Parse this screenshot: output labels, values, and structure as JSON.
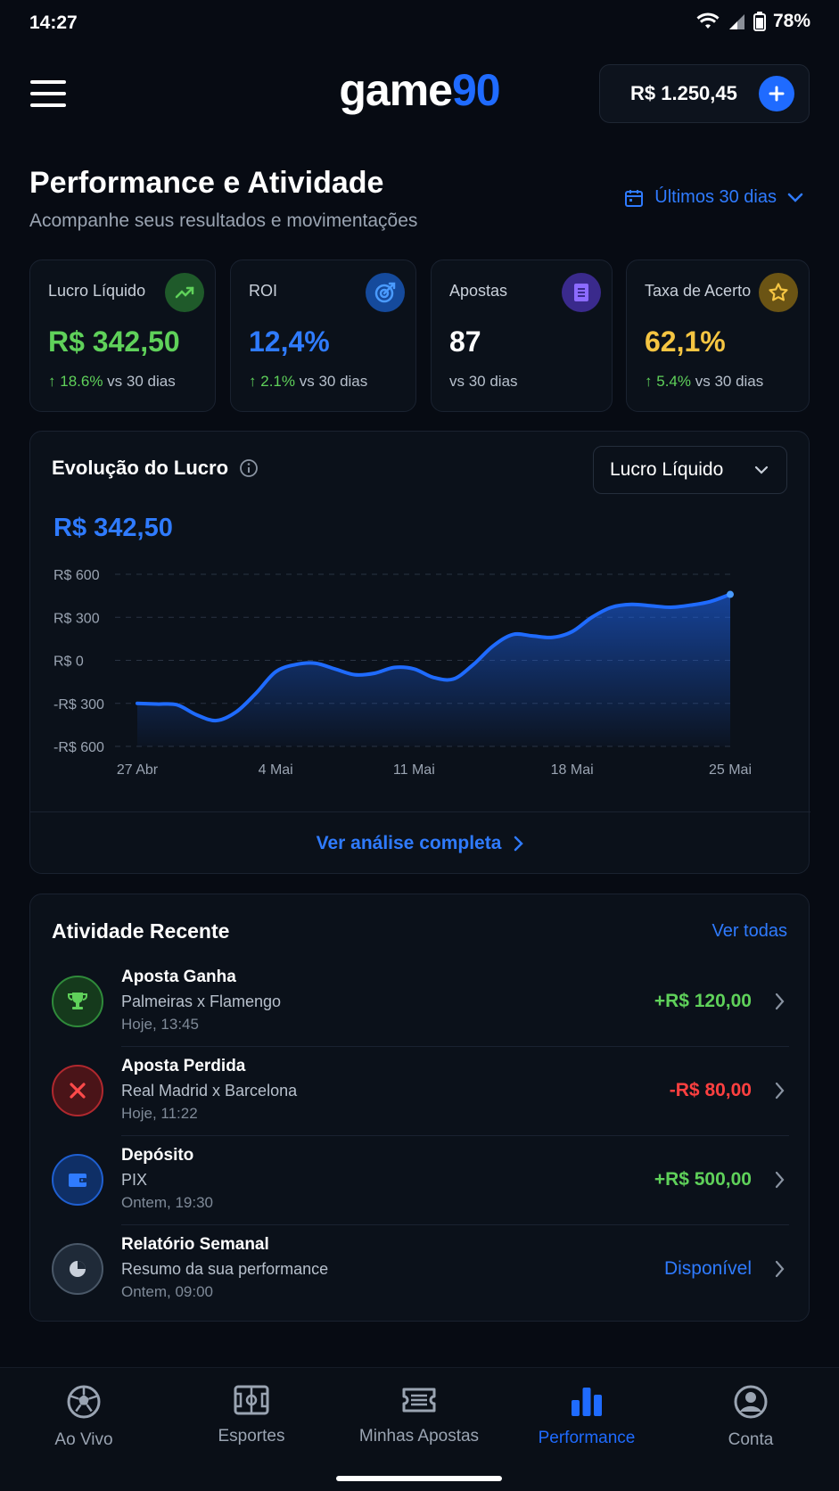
{
  "status_bar": {
    "time": "14:27",
    "battery": "78%"
  },
  "header": {
    "logo_main": "game",
    "logo_accent": "90",
    "balance": "R$ 1.250,45"
  },
  "page": {
    "title": "Performance e Atividade",
    "subtitle": "Acompanhe seus resultados e movimentações",
    "period": "Últimos 30 dias"
  },
  "stats": [
    {
      "label": "Lucro Líquido",
      "value": "R$ 342,50",
      "delta": "18.6%",
      "suffix": "vs 30 dias",
      "color": "#5fd15a",
      "icon": "trend-up-icon"
    },
    {
      "label": "ROI",
      "value": "12,4%",
      "delta": "2.1%",
      "suffix": "vs 30 dias",
      "color": "#2f7bff",
      "icon": "target-icon"
    },
    {
      "label": "Apostas",
      "value": "87",
      "delta": "",
      "suffix": "vs 30 dias",
      "color": "#ffffff",
      "icon": "ticket-icon"
    },
    {
      "label": "Taxa de Acerto",
      "value": "62,1%",
      "delta": "5.4%",
      "suffix": "vs 30 dias",
      "color": "#f5c542",
      "icon": "star-icon"
    }
  ],
  "chart": {
    "title": "Evolução do Lucro",
    "dropdown": "Lucro Líquido",
    "current_value": "R$ 342,50",
    "link": "Ver análise completa"
  },
  "chart_data": {
    "type": "area",
    "title": "Evolução do Lucro",
    "x_tick_labels": [
      "27 Abr",
      "4 Mai",
      "11 Mai",
      "18 Mai",
      "25 Mai"
    ],
    "y_tick_labels": [
      "R$ 600",
      "R$ 300",
      "R$ 0",
      "-R$ 300",
      "-R$ 600"
    ],
    "ylim": [
      -600,
      600
    ],
    "grid": true,
    "series": [
      {
        "x": [
          0,
          1,
          2,
          3,
          4,
          5,
          6,
          7,
          8,
          9,
          10,
          11,
          12,
          13,
          14,
          15,
          16,
          17,
          18,
          19,
          20,
          21,
          22,
          23,
          24,
          25,
          26,
          27,
          28,
          29,
          30
        ],
        "values": [
          -300,
          -305,
          -310,
          -380,
          -420,
          -360,
          -230,
          -80,
          -30,
          -20,
          -60,
          -100,
          -90,
          -50,
          -60,
          -120,
          -130,
          -30,
          100,
          180,
          170,
          160,
          200,
          300,
          370,
          390,
          380,
          370,
          385,
          410,
          460
        ]
      }
    ],
    "x_ticks_at": [
      0,
      7,
      14,
      22,
      30
    ],
    "color": "#1f6bff"
  },
  "activity": {
    "title": "Atividade Recente",
    "view_all": "Ver todas",
    "items": [
      {
        "title": "Aposta Ganha",
        "subtitle": "Palmeiras x Flamengo",
        "time": "Hoje, 13:45",
        "amount": "+R$ 120,00",
        "color": "#5fd15a",
        "icon": "trophy-icon"
      },
      {
        "title": "Aposta Perdida",
        "subtitle": "Real Madrid x Barcelona",
        "time": "Hoje, 11:22",
        "amount": "-R$ 80,00",
        "color": "#ff4040",
        "icon": "close-icon"
      },
      {
        "title": "Depósito",
        "subtitle": "PIX",
        "time": "Ontem, 19:30",
        "amount": "+R$ 500,00",
        "color": "#5fd15a",
        "icon": "wallet-icon"
      },
      {
        "title": "Relatório Semanal",
        "subtitle": "Resumo da sua performance",
        "time": "Ontem, 09:00",
        "amount": "Disponível",
        "color": "#2f7bff",
        "icon": "pie-chart-icon"
      }
    ]
  },
  "nav": [
    {
      "label": "Ao Vivo",
      "icon": "soccer-ball-icon"
    },
    {
      "label": "Esportes",
      "icon": "field-icon"
    },
    {
      "label": "Minhas Apostas",
      "icon": "ticket-icon"
    },
    {
      "label": "Performance",
      "icon": "bar-chart-icon",
      "active": true
    },
    {
      "label": "Conta",
      "icon": "user-icon"
    }
  ]
}
